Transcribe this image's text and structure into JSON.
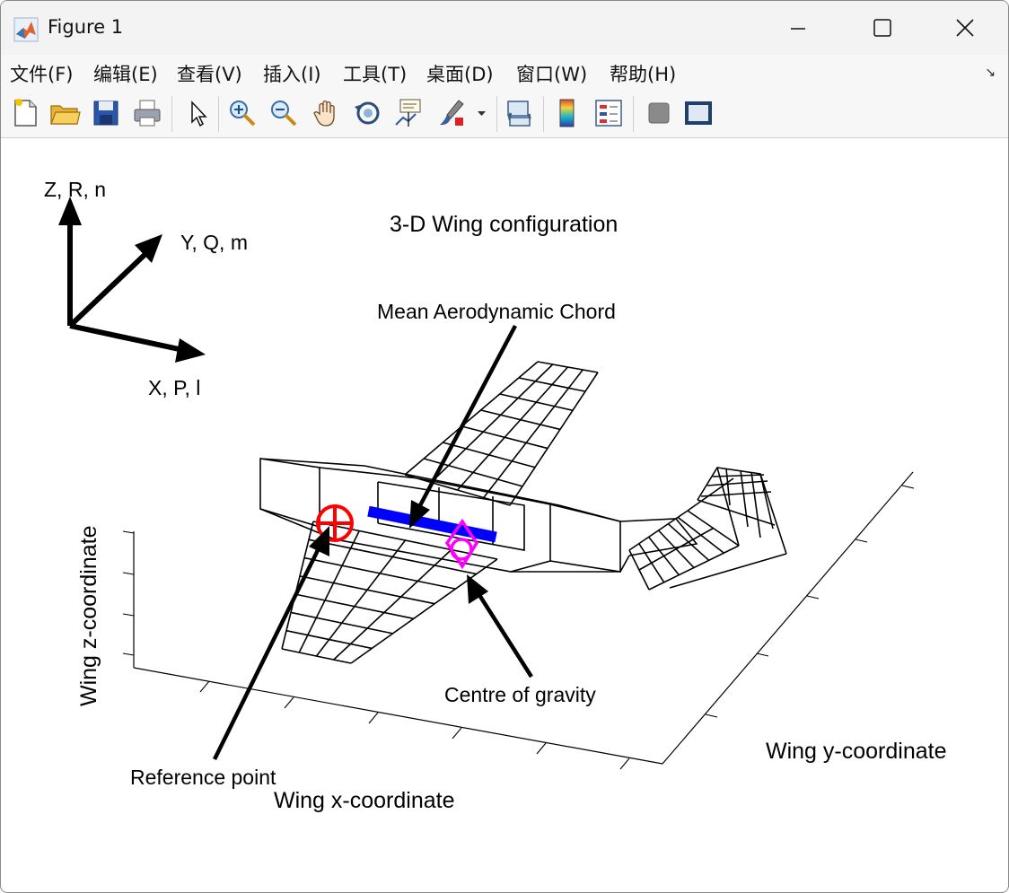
{
  "window": {
    "title": "Figure 1",
    "controls": [
      "minimize",
      "maximize",
      "close"
    ]
  },
  "menu": [
    {
      "label": "文件(F)"
    },
    {
      "label": "编辑(E)"
    },
    {
      "label": "查看(V)"
    },
    {
      "label": "插入(I)"
    },
    {
      "label": "工具(T)"
    },
    {
      "label": "桌面(D)"
    },
    {
      "label": "窗口(W)"
    },
    {
      "label": "帮助(H)"
    }
  ],
  "toolbar": [
    {
      "icon": "new-figure-icon"
    },
    {
      "icon": "open-file-icon"
    },
    {
      "icon": "save-icon"
    },
    {
      "icon": "print-icon"
    },
    {
      "icon": "edit-plot-arrow-icon"
    },
    {
      "icon": "zoom-in-icon"
    },
    {
      "icon": "zoom-out-icon"
    },
    {
      "icon": "pan-hand-icon"
    },
    {
      "icon": "rotate-3d-icon"
    },
    {
      "icon": "data-cursor-icon"
    },
    {
      "icon": "brush-icon"
    },
    {
      "icon": "link-plot-icon"
    },
    {
      "icon": "insert-colorbar-icon"
    },
    {
      "icon": "insert-legend-icon"
    },
    {
      "icon": "hide-plot-tools-icon"
    },
    {
      "icon": "show-plot-tools-icon"
    }
  ],
  "plot": {
    "title": "3-D Wing configuration",
    "xlabel": "Wing x-coordinate",
    "ylabel": "Wing y-coordinate",
    "zlabel": "Wing z-coordinate",
    "axis_triad": {
      "z": "Z, R, n",
      "y": "Y, Q, m",
      "x": "X, P, l"
    },
    "annotations": {
      "mac": "Mean Aerodynamic Chord",
      "cg": "Centre of gravity",
      "ref": "Reference point"
    },
    "colors": {
      "mac": "#0000ff",
      "reference_point": "#ff0000",
      "centre_of_gravity": "#ff00ff",
      "wireframe": "#000000"
    }
  }
}
